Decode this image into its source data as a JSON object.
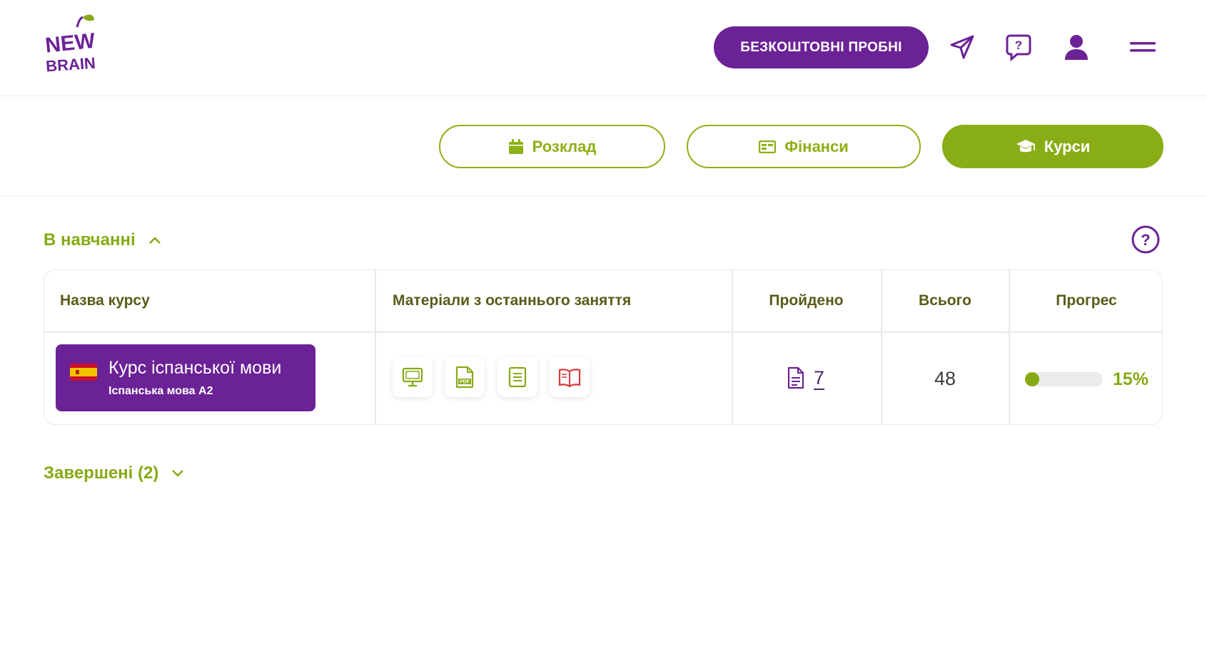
{
  "header": {
    "logo_text": [
      "NEW",
      "BRAIN"
    ],
    "trial_button": "БЕЗКОШТОВНІ  ПРОБНІ",
    "icons": [
      "send-icon",
      "help-chat-icon",
      "user-icon",
      "menu-icon"
    ]
  },
  "nav": {
    "schedule": "Розклад",
    "finance": "Фінанси",
    "courses": "Курси",
    "active": "courses"
  },
  "sections": {
    "in_progress": "В навчанні",
    "completed": "Завершені (2)"
  },
  "table": {
    "headers": {
      "course": "Назва курсу",
      "materials": "Матеріали з останнього заняття",
      "done": "Пройдено",
      "total": "Всього",
      "progress": "Прогрес"
    },
    "rows": [
      {
        "course_title": "Курс іспанської мови",
        "course_subtitle": "Іспанська мова А2",
        "flag": "spain-flag",
        "materials": [
          "presentation-icon",
          "pdf-icon",
          "text-document-icon",
          "book-icon"
        ],
        "done": "7",
        "total": "48",
        "progress_percent": 15,
        "progress_label": "15%"
      }
    ]
  },
  "colors": {
    "brand_purple": "#6b2296",
    "brand_green": "#86aa14",
    "header_text": "#5b5a1a",
    "book_icon_red": "#d63a3a"
  }
}
